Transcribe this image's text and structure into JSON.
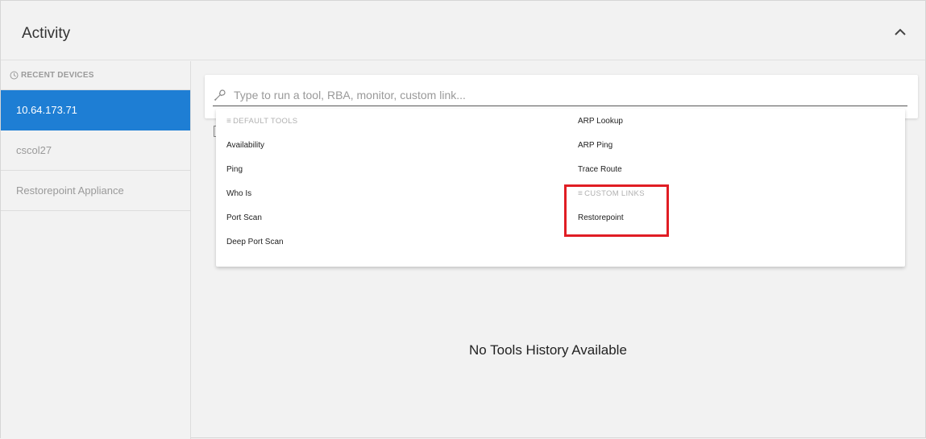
{
  "panel": {
    "title": "Activity"
  },
  "sidebar": {
    "heading": "RECENT DEVICES",
    "devices": [
      {
        "label": "10.64.173.71",
        "active": true
      },
      {
        "label": "cscol27",
        "active": false
      },
      {
        "label": "Restorepoint Appliance",
        "active": false
      }
    ]
  },
  "search": {
    "placeholder": "Type to run a tool, RBA, monitor, custom link...",
    "value": ""
  },
  "dropdown": {
    "default_tools_heading": "DEFAULT TOOLS",
    "default_tools_left": [
      "Availability",
      "Ping",
      "Who Is",
      "Port Scan",
      "Deep Port Scan"
    ],
    "default_tools_right": [
      "ARP Lookup",
      "ARP Ping",
      "Trace Route"
    ],
    "custom_links_heading": "CUSTOM LINKS",
    "custom_links": [
      "Restorepoint"
    ]
  },
  "main": {
    "empty_message": "No Tools History Available"
  },
  "colors": {
    "accent": "#1e7ed4",
    "highlight": "#e01d24",
    "background": "#f2f2f2"
  },
  "icons": {
    "collapse": "chevron-up-icon",
    "recent": "clock-icon",
    "search": "wrench-icon",
    "section": "hamburger-icon"
  }
}
